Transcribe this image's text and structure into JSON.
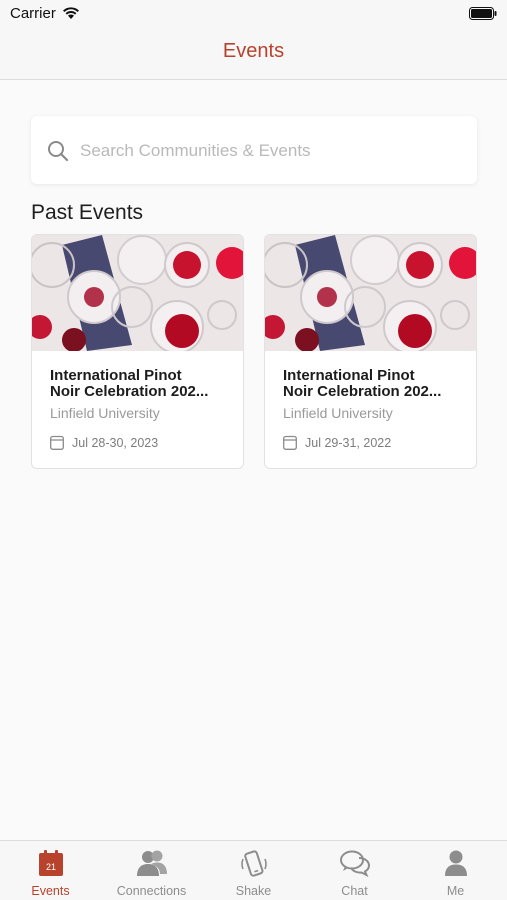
{
  "status_bar": {
    "carrier": "Carrier"
  },
  "nav": {
    "title": "Events"
  },
  "search": {
    "placeholder": "Search Communities & Events",
    "value": ""
  },
  "section": {
    "title": "Past Events"
  },
  "events": [
    {
      "title_line1": "International Pinot",
      "title_line2": "Noir Celebration 202...",
      "venue": "Linfield University",
      "date": "Jul 28-30, 2023"
    },
    {
      "title_line1": "International Pinot",
      "title_line2": "Noir Celebration 202...",
      "venue": "Linfield University",
      "date": "Jul 29-31, 2022"
    }
  ],
  "tabs": [
    {
      "label": "Events",
      "icon": "calendar-icon",
      "badge": "21",
      "active": true
    },
    {
      "label": "Connections",
      "icon": "people-icon",
      "active": false
    },
    {
      "label": "Shake",
      "icon": "shake-phone-icon",
      "active": false
    },
    {
      "label": "Chat",
      "icon": "chat-bubbles-icon",
      "active": false
    },
    {
      "label": "Me",
      "icon": "person-icon",
      "active": false
    }
  ],
  "colors": {
    "accent": "#b8432d",
    "inactive": "#8d8d8d",
    "background": "#fafafa"
  }
}
